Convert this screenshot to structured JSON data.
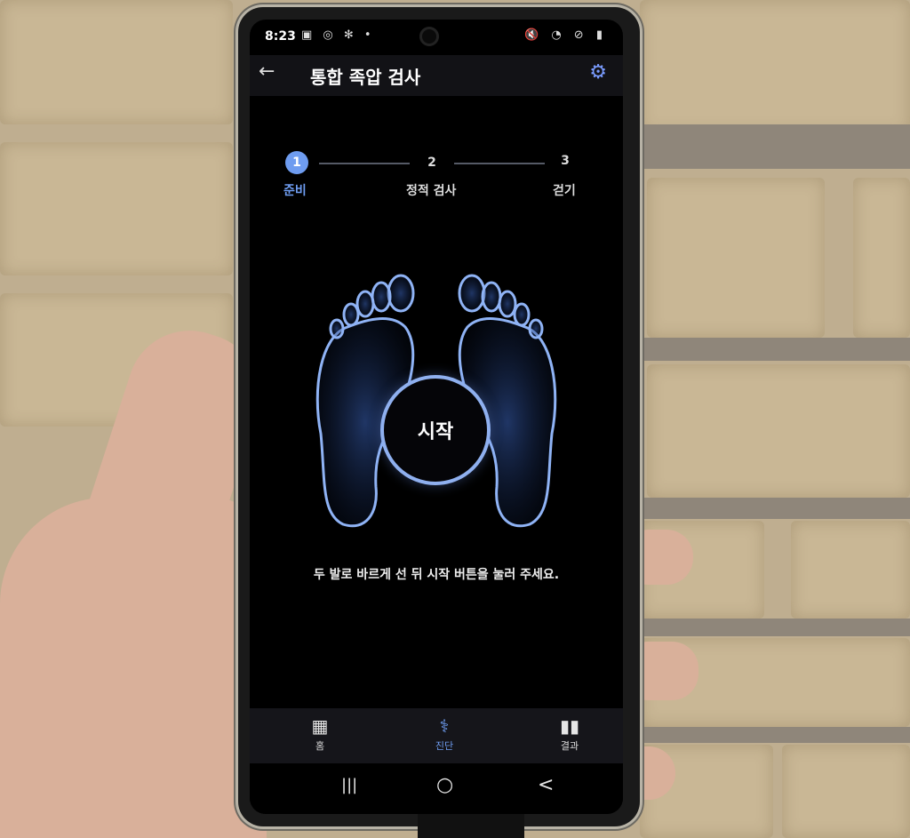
{
  "status_bar": {
    "time": "8:23",
    "left_icons": "▣ ◎ ✻ •",
    "right_icons": "🔇 ◔ ⊘ ▮"
  },
  "app_bar": {
    "back_icon": "arrow-left-icon",
    "title": "통합 족압 검사",
    "settings_icon": "gear-icon"
  },
  "stepper": {
    "steps": [
      {
        "number": "1",
        "label": "준비",
        "active": true
      },
      {
        "number": "2",
        "label": "정적 검사",
        "active": false
      },
      {
        "number": "3",
        "label": "걷기",
        "active": false
      }
    ]
  },
  "main": {
    "start_button": "시작",
    "instruction": "두 발로 바르게 선 뒤 시작 버튼을 눌러 주세요."
  },
  "bottom_nav": {
    "items": [
      {
        "label": "홈",
        "icon": "grid-icon",
        "active": false
      },
      {
        "label": "진단",
        "icon": "stethoscope-icon",
        "active": true
      },
      {
        "label": "결과",
        "icon": "bar-chart-icon",
        "active": false
      }
    ]
  },
  "system_nav": {
    "recents": "|||",
    "home": "○",
    "back": "<"
  },
  "colors": {
    "accent": "#6e9cf0",
    "screen_bg": "#000000",
    "appbar_bg": "#121216"
  }
}
